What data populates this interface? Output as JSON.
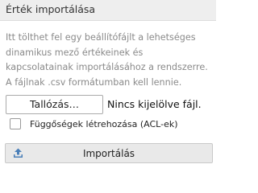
{
  "panel": {
    "title": "Érték importálása",
    "description": "Itt tölthet fel egy beállítófájlt a lehetséges dinamikus mező értékeinek és kapcsolatainak importálásához a rendszerre. A fájlnak .csv formátumban kell lennie."
  },
  "file_input": {
    "browse_label": "Tallózás…",
    "status": "Nincs kijelölve fájl."
  },
  "options": {
    "create_dependencies_label": "Függőségek létrehozása (ACL-ek)",
    "create_dependencies_checked": false
  },
  "import_button": {
    "label": "Importálás",
    "icon": "upload-icon"
  },
  "colors": {
    "header_bg": "#eeeeee",
    "description_text": "#8a8a8a",
    "upload_icon": "#4a7fb8",
    "import_button_bg": "#e9e9e9"
  }
}
